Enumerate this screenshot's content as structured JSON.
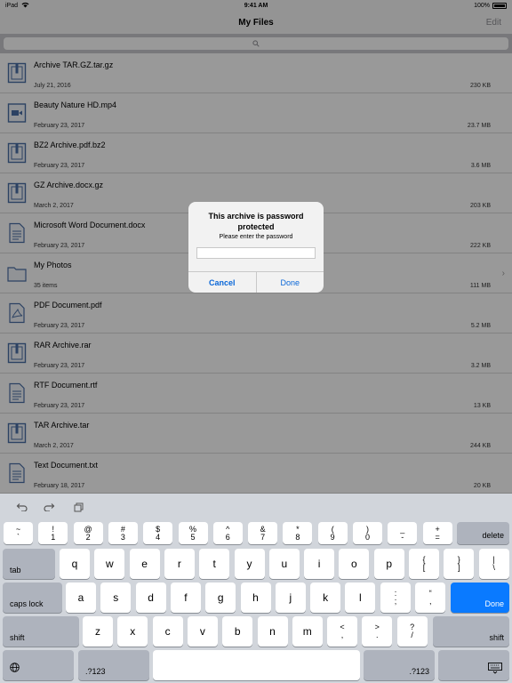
{
  "status": {
    "device": "iPad",
    "time": "9:41 AM",
    "battery": "100%"
  },
  "nav": {
    "title": "My Files",
    "edit": "Edit"
  },
  "files": [
    {
      "name": "Archive TAR.GZ.tar.gz",
      "date": "July 21, 2016",
      "size": "230 KB",
      "icon": "archive-icon"
    },
    {
      "name": "Beauty Nature HD.mp4",
      "date": "February 23, 2017",
      "size": "23.7 MB",
      "icon": "video-icon"
    },
    {
      "name": "BZ2 Archive.pdf.bz2",
      "date": "February 23, 2017",
      "size": "3.6 MB",
      "icon": "archive-icon"
    },
    {
      "name": "GZ Archive.docx.gz",
      "date": "March 2, 2017",
      "size": "203 KB",
      "icon": "archive-icon"
    },
    {
      "name": "Microsoft Word Document.docx",
      "date": "February 23, 2017",
      "size": "222 KB",
      "icon": "document-icon"
    },
    {
      "name": "My Photos",
      "date": "35 items",
      "size": "111 MB",
      "icon": "folder-icon"
    },
    {
      "name": "PDF Document.pdf",
      "date": "February 23, 2017",
      "size": "5.2 MB",
      "icon": "pdf-icon"
    },
    {
      "name": "RAR Archive.rar",
      "date": "February 23, 2017",
      "size": "3.2 MB",
      "icon": "archive-icon"
    },
    {
      "name": "RTF Document.rtf",
      "date": "February 23, 2017",
      "size": "13 KB",
      "icon": "document-icon"
    },
    {
      "name": "TAR Archive.tar",
      "date": "March 2, 2017",
      "size": "244 KB",
      "icon": "archive-icon"
    },
    {
      "name": "Text Document.txt",
      "date": "February 18, 2017",
      "size": "20 KB",
      "icon": "document-icon"
    }
  ],
  "alert": {
    "title": "This archive is password protected",
    "message": "Please enter the password",
    "input_value": "",
    "cancel": "Cancel",
    "done": "Done"
  },
  "keyboard": {
    "row1": [
      [
        "~",
        "`"
      ],
      [
        "!",
        "1"
      ],
      [
        "@",
        "2"
      ],
      [
        "#",
        "3"
      ],
      [
        "%",
        "5"
      ],
      [
        "^",
        "6"
      ],
      [
        "&",
        "7"
      ],
      [
        "*",
        "8"
      ],
      [
        "(",
        "9"
      ],
      [
        ")",
        "0"
      ],
      [
        "_",
        "-"
      ],
      [
        "+",
        "="
      ]
    ],
    "row1_dollar": [
      "$",
      "4"
    ],
    "delete": "delete",
    "tab": "tab",
    "row2": [
      "q",
      "w",
      "e",
      "r",
      "t",
      "y",
      "u",
      "i",
      "o",
      "p"
    ],
    "row2_extra": [
      [
        "{",
        "["
      ],
      [
        "}",
        "]"
      ],
      [
        "|",
        "\\"
      ]
    ],
    "caps": "caps lock",
    "row3": [
      "a",
      "s",
      "d",
      "f",
      "g",
      "h",
      "j",
      "k",
      "l"
    ],
    "row3_extra": [
      [
        ":",
        ";"
      ],
      [
        "“",
        ","
      ]
    ],
    "done": "Done",
    "shift": "shift",
    "row4": [
      "z",
      "x",
      "c",
      "v",
      "b",
      "n",
      "m"
    ],
    "row4_extra": [
      [
        "<",
        ","
      ],
      [
        ">",
        "."
      ],
      [
        "?",
        "/"
      ]
    ],
    "numbers": ".?123"
  },
  "colors": {
    "accent": "#0a67d8",
    "done_key": "#0a7aff",
    "keyboard_bg": "#d1d5db"
  }
}
